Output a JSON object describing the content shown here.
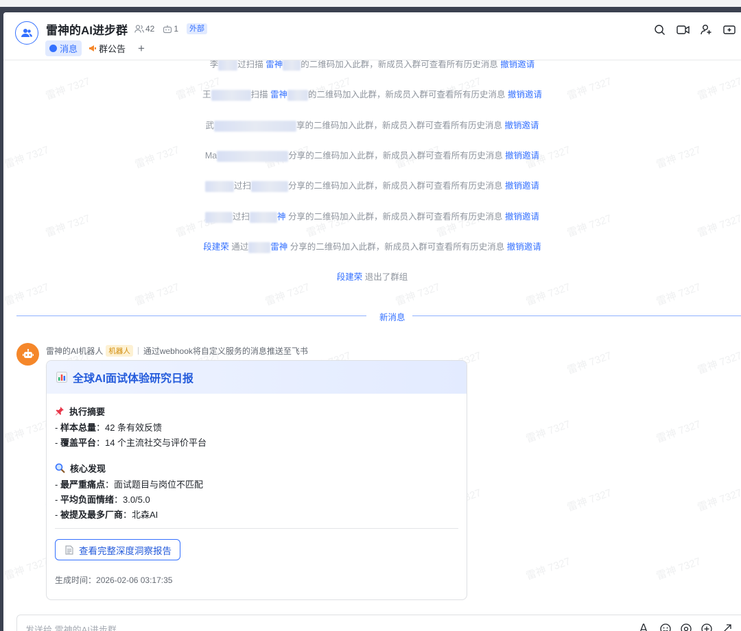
{
  "header": {
    "title": "雷神的AI进步群",
    "member_count": "42",
    "bot_count": "1",
    "external_badge": "外部",
    "tabs": [
      {
        "label": "消息"
      },
      {
        "label": "群公告"
      }
    ],
    "add_tab": "+"
  },
  "system_messages": [
    {
      "pre": "李",
      "mid1": "过扫描 ",
      "inviter": "雷神",
      "mid2": "的二维码加入此群，新成员入群可查看所有历史消息 ",
      "action": "撤销邀请"
    },
    {
      "pre": "王",
      "mid1": "扫描 ",
      "inviter": "雷神",
      "mid2": "的二维码加入此群，新成员入群可查看所有历史消息 ",
      "action": "撤销邀请"
    },
    {
      "pre": "武",
      "mid1": "",
      "inviter": "",
      "mid2": "享的二维码加入此群，新成员入群可查看所有历史消息 ",
      "action": "撤销邀请"
    },
    {
      "pre": "Ma",
      "mid1": "",
      "inviter": "",
      "mid2": "分享的二维码加入此群，新成员入群可查看所有历史消息 ",
      "action": "撤销邀请"
    },
    {
      "pre": "",
      "mid1": "过扫",
      "inviter": "",
      "mid2": "分享的二维码加入此群，新成员入群可查看所有历史消息 ",
      "action": "撤销邀请"
    },
    {
      "pre": "",
      "mid1": "过扫",
      "inviter": "神",
      "mid2": " 分享的二维码加入此群，新成员入群可查看所有历史消息 ",
      "action": "撤销邀请"
    },
    {
      "pre": "段建荣",
      "mid1": " 通过",
      "inviter": "雷神",
      "mid2": " 分享的二维码加入此群，新成员入群可查看所有历史消息 ",
      "action": "撤销邀请"
    }
  ],
  "leave_message": {
    "name": "段建荣",
    "text": " 退出了群组"
  },
  "new_messages_divider": "新消息",
  "watermark": "雷神 7327",
  "bot_message": {
    "sender": "雷神的AI机器人",
    "tag": "机器人",
    "via": "通过webhook将自定义服务的消息推送至飞书",
    "card": {
      "title": "全球AI面试体验研究日报",
      "section1": {
        "heading": "执行摘要",
        "items": [
          {
            "label": "样本总量",
            "value": "42 条有效反馈"
          },
          {
            "label": "覆盖平台",
            "value": "14 个主流社交与评价平台"
          }
        ]
      },
      "section2": {
        "heading": "核心发现",
        "items": [
          {
            "label": "最严重痛点",
            "value": "面试题目与岗位不匹配"
          },
          {
            "label": "平均负面情绪",
            "value": "3.0/5.0"
          },
          {
            "label": "被提及最多厂商",
            "value": "北森AI"
          }
        ]
      },
      "button_label": "查看完整深度洞察报告",
      "generated_label": "生成时间",
      "generated_time": "2026-02-06 03:17:35"
    }
  },
  "composer": {
    "placeholder": "发送给 雷神的AI进步群"
  },
  "colors": {
    "accent": "#3370ff",
    "bot_avatar": "#f5872a",
    "frame": "#3b4150"
  }
}
